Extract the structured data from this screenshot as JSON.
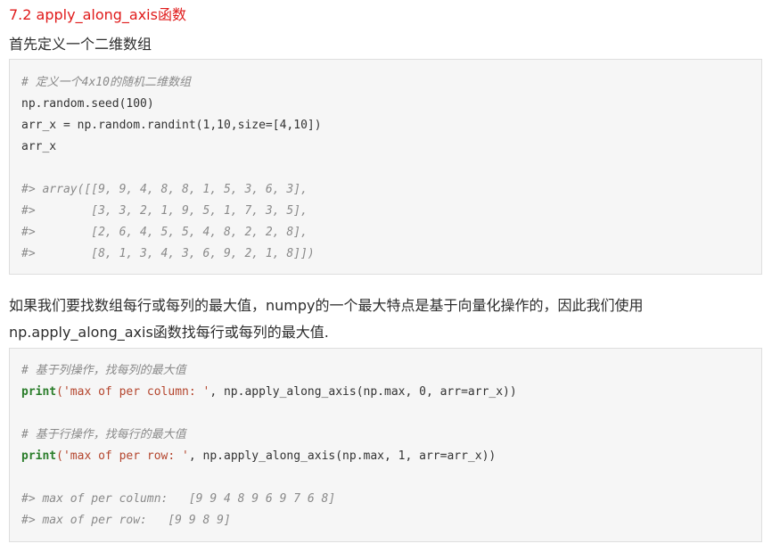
{
  "section": {
    "heading": "7.2 apply_along_axis函数",
    "intro": "首先定义一个二维数组"
  },
  "code1": {
    "comment": "# 定义一个4x10的随机二维数组",
    "l1": "np.random.seed(100)",
    "l2": "arr_x = np.random.randint(1,10,size=[4,10])",
    "l3": "arr_x",
    "out1": "#> array([[9, 9, 4, 8, 8, 1, 5, 3, 6, 3],",
    "out2": "#>        [3, 3, 2, 1, 9, 5, 1, 7, 3, 5],",
    "out3": "#>        [2, 6, 4, 5, 5, 4, 8, 2, 2, 8],",
    "out4": "#>        [8, 1, 3, 4, 3, 6, 9, 2, 1, 8]])"
  },
  "para2": {
    "line1": "如果我们要找数组每行或每列的最大值，numpy的一个最大特点是基于向量化操作的，因此我们使用",
    "line2": "np.apply_along_axis函数找每行或每列的最大值."
  },
  "code2": {
    "c1": "# 基于列操作，找每列的最大值",
    "p1_kw": "print",
    "p1_str": "('max of per column: '",
    "p1_rest": ", np.apply_along_axis(np.max, 0, arr=arr_x))",
    "c2": "# 基于行操作，找每行的最大值",
    "p2_kw": "print",
    "p2_str": "('max of per row: '",
    "p2_rest": ", np.apply_along_axis(np.max, 1, arr=arr_x))",
    "o1": "#> max of per column:   [9 9 4 8 9 6 9 7 6 8]",
    "o2": "#> max of per row:   [9 9 8 9]"
  }
}
